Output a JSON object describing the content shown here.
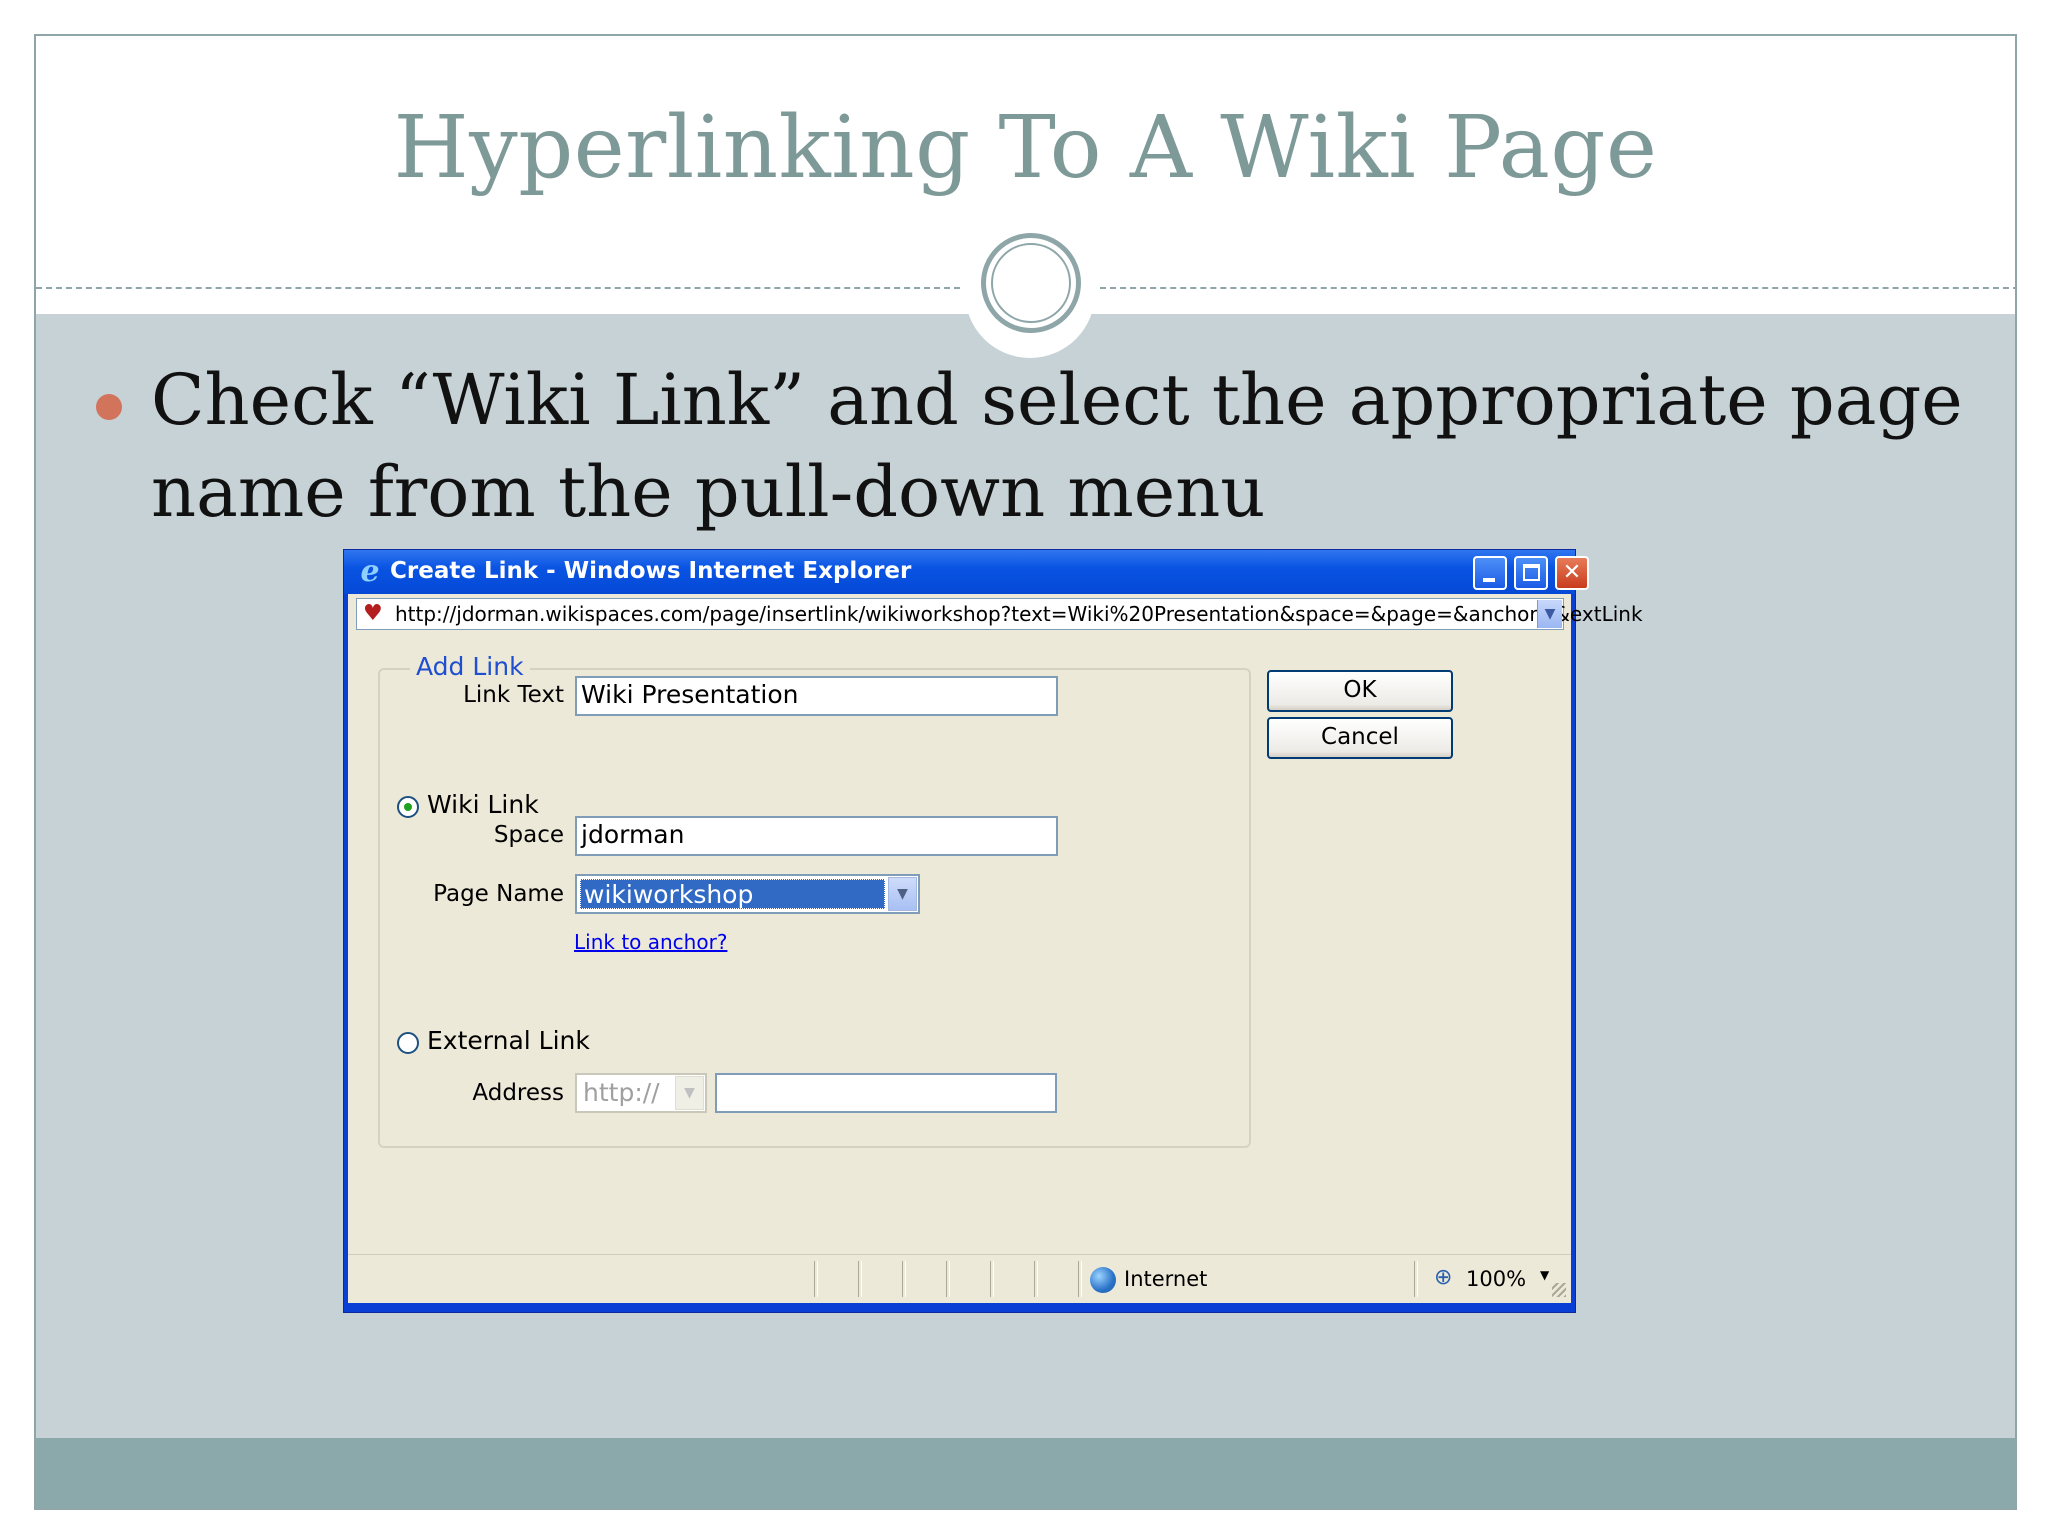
{
  "slide": {
    "title": "Hyperlinking To A Wiki Page",
    "bullet": "Check “Wiki Link” and select the appropriate page name from the pull-down menu"
  },
  "window": {
    "title": "Create Link - Windows Internet Explorer",
    "controls": {
      "minimize": "",
      "maximize": "",
      "close": "✕"
    },
    "address_url": "http://jdorman.wikispaces.com/page/insertlink/wikiworkshop?text=Wiki%20Presentation&space=&page=&anchor=&extLink"
  },
  "form": {
    "group_legend": "Add Link",
    "link_text_label": "Link Text",
    "link_text_value": "Wiki Presentation",
    "wiki_link_label": "Wiki Link",
    "wiki_link_checked": true,
    "space_label": "Space",
    "space_value": "jdorman",
    "page_name_label": "Page Name",
    "page_name_value": "wikiworkshop",
    "anchor_link": "Link to anchor?",
    "external_link_label": "External Link",
    "external_link_checked": false,
    "address_label": "Address",
    "protocol_value": "http://",
    "address_value": ""
  },
  "buttons": {
    "ok": "OK",
    "cancel": "Cancel"
  },
  "statusbar": {
    "zone": "Internet",
    "zoom": "100%"
  },
  "colors": {
    "slide_title": "#7e9a98",
    "slide_background": "#c6d2d6",
    "bullet": "#d2735c",
    "footer": "#8ba9aa",
    "xp_titlebar": "#0a54e3",
    "legend_blue": "#1f4fd0",
    "selection": "#316ac5"
  }
}
